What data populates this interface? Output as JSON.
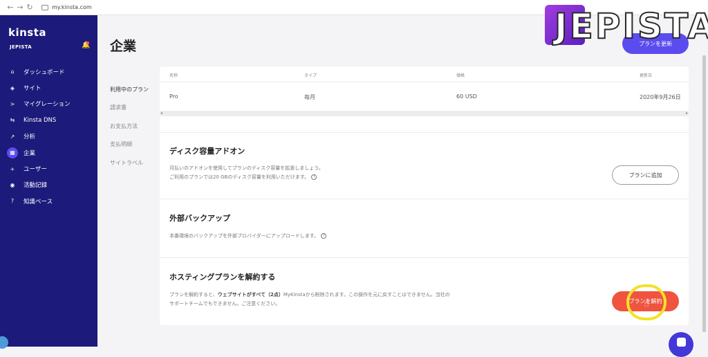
{
  "browser": {
    "url": "my.kinsta.com",
    "back": "←",
    "forward": "→",
    "reload": "↻"
  },
  "sidebar": {
    "logo": "kinsta",
    "company": "JEPISTA",
    "items": [
      {
        "label": "ダッシュボード",
        "icon": "⌂"
      },
      {
        "label": "サイト",
        "icon": "◈"
      },
      {
        "label": "マイグレーション",
        "icon": ">"
      },
      {
        "label": "Kinsta DNS",
        "icon": "⇆"
      },
      {
        "label": "分析",
        "icon": "↗"
      },
      {
        "label": "企業",
        "icon": "▦",
        "active": true
      },
      {
        "label": "ユーザー",
        "icon": "+"
      },
      {
        "label": "活動記録",
        "icon": "◉"
      },
      {
        "label": "知識ベース",
        "icon": "?"
      }
    ]
  },
  "page": {
    "title": "企業",
    "primary_button": "プランを更新"
  },
  "watermark": "JEPISTA",
  "subnav": [
    "利用中のプラン",
    "請求書",
    "お支払方法",
    "支払明細",
    "サイトラベル"
  ],
  "plan_table": {
    "headers": {
      "name": "名称",
      "type": "タイプ",
      "price": "価格",
      "updated": "更新日"
    },
    "row": {
      "name": "Pro",
      "type": "毎月",
      "price": "60 USD",
      "updated": "2020年9月26日"
    },
    "scroll_left": "◂",
    "scroll_right": "▸"
  },
  "disk_addon": {
    "title": "ディスク容量アドオン",
    "line1": "月払いのアドオンを使用してプランのディスク容量を拡張しましょう。",
    "line2": "ご利用のプランでは20 GBのディスク容量を利用いただけます。",
    "button": "プランに追加"
  },
  "external_backup": {
    "title": "外部バックアップ",
    "text": "本番環境のバックアップを外部プロバイダーにアップロードします。"
  },
  "cancel_plan": {
    "title": "ホスティングプランを解約する",
    "line1_a": "プランを解約すると、",
    "line1_bold": "ウェブサイトがすべて（2点）",
    "line1_b": "MyKinstaから削除されます。この操作を元に戻すことはできません。当社の",
    "line2": "サポートチームでもできません。ご注意ください。",
    "button": "プランを解約"
  },
  "info_glyph": "?",
  "cursor_glyph": "☝",
  "colors": {
    "sidebar": "#1c1a7a",
    "accent": "#5b4cf0",
    "danger": "#f0533e",
    "highlight": "#f2e22a"
  }
}
